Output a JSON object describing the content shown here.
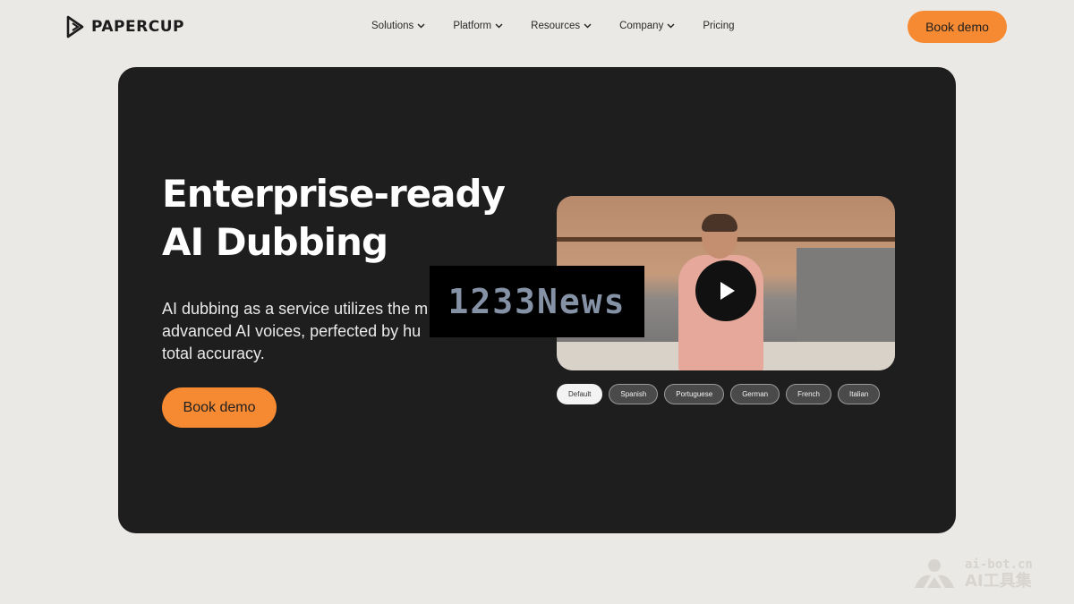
{
  "header": {
    "logo_text": "PAPERCUP",
    "nav": [
      {
        "label": "Solutions",
        "icon": "chevron-down-icon"
      },
      {
        "label": "Platform",
        "icon": "chevron-down-icon"
      },
      {
        "label": "Resources",
        "icon": "chevron-down-icon"
      },
      {
        "label": "Company",
        "icon": "chevron-down-icon"
      },
      {
        "label": "Pricing"
      }
    ],
    "cta_label": "Book demo"
  },
  "hero": {
    "title_line1": "Enterprise-ready",
    "title_line2": "AI Dubbing",
    "desc_line1": "AI dubbing as a service utilizes the m",
    "desc_line2": "advanced AI voices, perfected by hu",
    "desc_line3": "total accuracy.",
    "cta_label": "Book demo"
  },
  "video": {
    "play_icon": "play-icon",
    "languages": [
      {
        "label": "Default",
        "active": true
      },
      {
        "label": "Spanish"
      },
      {
        "label": "Portuguese"
      },
      {
        "label": "German"
      },
      {
        "label": "French"
      },
      {
        "label": "Italian"
      }
    ]
  },
  "overlay_watermark": "1233News",
  "corner_watermark": {
    "url": "ai-bot.cn",
    "name": "AI工具集"
  },
  "colors": {
    "background": "#ebe9e5",
    "hero_bg": "#1f1e1f",
    "accent": "#f68a33"
  }
}
